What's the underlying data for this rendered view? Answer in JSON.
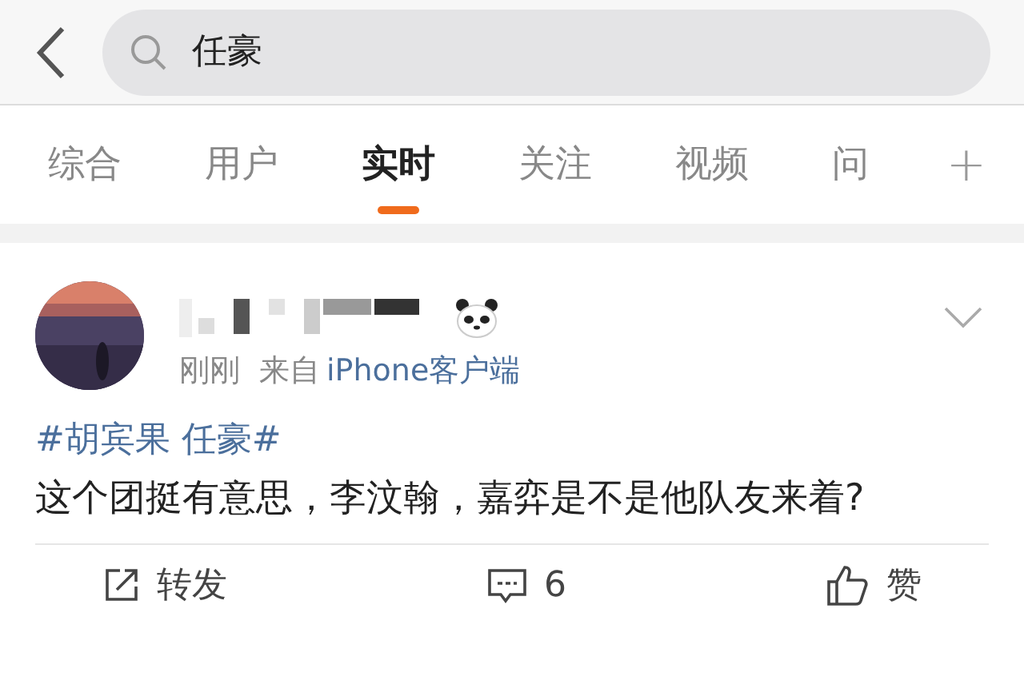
{
  "search": {
    "value": "任豪"
  },
  "tabs": [
    {
      "label": "综合",
      "selected": false
    },
    {
      "label": "用户",
      "selected": false
    },
    {
      "label": "实时",
      "selected": true
    },
    {
      "label": "关注",
      "selected": false
    },
    {
      "label": "视频",
      "selected": false
    },
    {
      "label": "问",
      "selected": false
    }
  ],
  "add_tab": "+",
  "post": {
    "time": "刚刚",
    "source_prefix": "来自",
    "source": "iPhone客户端",
    "hashtag": "#胡宾果 任豪#",
    "text": "这个团挺有意思，李汶翰，嘉弈是不是他队友来着?",
    "actions": [
      {
        "kind": "repost",
        "label": "转发"
      },
      {
        "kind": "comment",
        "label": "6"
      },
      {
        "kind": "like",
        "label": "赞"
      }
    ]
  }
}
